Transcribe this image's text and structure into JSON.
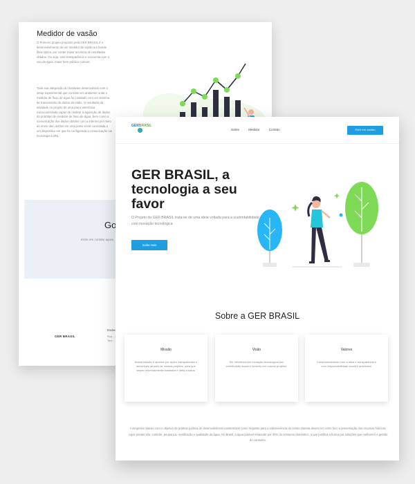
{
  "back_page": {
    "heading": "Medidor de vasão",
    "paragraph1": "O Primeiro projeto proposto pela GER BRASIL é o desenvolvimento de um medidor de vazão um bonde fibra óptica, por conter maior acurácia de resultados obtidos. Ou seja, total transparência e economia com o uso da água, maior bem público comum.",
    "paragraph2": "Toda sua integração do hardware desenvolvido com o setup experimental que consiste em ambiente onde o medidor de fluxo de água foi instalado com um sistema de transmissão de dados via rádio. O resultado da atividade no projeto de uma placa eletrônica microcontrolada capaz de realizar a aquisição de dados do protótipo de medidor de fluxo de água, bem como a comunicação dos dados obtidos com a internet por meio do envio das vazões em uma porta serial conectada a um dispositivo em que foi configurada a comunicação via tecnologia LoRa.",
    "banner_title": "Go",
    "banner_subtitle": "Entre em contato agora",
    "footer_logo": "GER BRASIL",
    "footer_address_label": "Endereço",
    "footer_address_lines": [
      "Rua ...",
      "Tere ..."
    ]
  },
  "front_page": {
    "logo": {
      "ger": "GER",
      "brasil": "BRASIL"
    },
    "nav": {
      "items": [
        "Sobre",
        "Medidor",
        "Contato"
      ],
      "cta": "Entre em contato"
    },
    "hero": {
      "title": "GER BRASIL, a tecnologia a seu favor",
      "text": "O Projeto da GER BRASIL trata-se de uma ideia voltada para a sustentabilidade com inovação tecnológica",
      "cta": "Saiba mais"
    },
    "about": {
      "title": "Sobre a GER BRASIL",
      "cards": [
        {
          "title": "Missão",
          "text": "Nossa missão é apontar por ações transparentes e acessíveis através de nossos projetos, para que sejam universalmente avaliados e úteis a todos."
        },
        {
          "title": "Visão",
          "text": "Ser referência em inovação tecnológica com contribuição social e fomento em nossos projetos."
        },
        {
          "title": "Valores",
          "text": "Comprometimento com a ética e transparência e com responsabilidade social e ambiental."
        }
      ],
      "text": "A Empresa nasceu com o objetivo de praticar política de desenvolvimento sustentável como requisito para a sobrevivência do nosso planeta devem ter como foco a preservação dos recursos hídricos, cujos pontos são: controle, poupança, reutilização e qualidade da água. No Brasil, a água potável responde por 20% do consumo doméstico, o que justifica a busca por soluções que melhorem a gestão do consumo."
    }
  },
  "colors": {
    "accent_blue": "#1e9ee0",
    "tree_green": "#7ed957",
    "tree_blue": "#29b6f6",
    "person_teal": "#26c6da",
    "banner_bg": "#eaf0f6",
    "bar_dark": "#2f2e41"
  },
  "icons": [
    "chart-illustration",
    "woman-trees-illustration",
    "logo-mark-icon"
  ]
}
